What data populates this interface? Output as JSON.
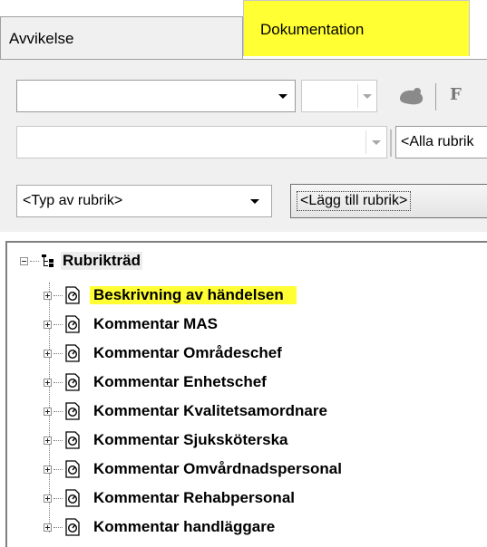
{
  "tabs": [
    {
      "label": "Avvikelse",
      "active": false
    },
    {
      "label": "Dokumentation",
      "active": true
    }
  ],
  "toolbar": {
    "combo1_value": "",
    "combo2_value": "",
    "font_button_label": "F",
    "combo3_value": "",
    "rubric_filter_value": "<Alla rubrik",
    "rubric_type_value": "<Typ av rubrik>",
    "add_rubric_label": "<Lägg till rubrik>"
  },
  "tree": {
    "root_label": "Rubrikträd",
    "items": [
      {
        "label": "Beskrivning av händelsen",
        "highlighted": true
      },
      {
        "label": "Kommentar MAS"
      },
      {
        "label": "Kommentar Områdeschef"
      },
      {
        "label": "Kommentar Enhetschef"
      },
      {
        "label": "Kommentar Kvalitetsamordnare"
      },
      {
        "label": "Kommentar Sjuksköterska"
      },
      {
        "label": "Kommentar Omvårdnadspersonal"
      },
      {
        "label": "Kommentar Rehabpersonal"
      },
      {
        "label": "Kommentar handläggare"
      }
    ]
  },
  "colors": {
    "highlight": "#ffff33",
    "panel_bg": "#f0f0f0"
  }
}
